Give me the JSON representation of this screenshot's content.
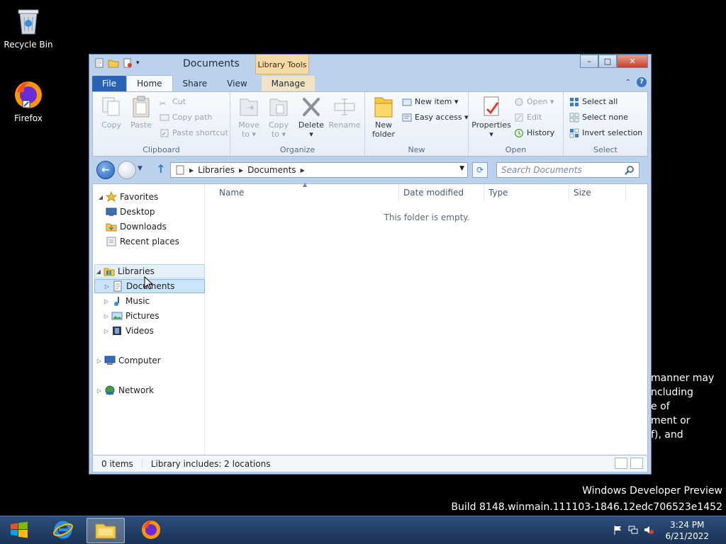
{
  "desktop": {
    "icons": [
      {
        "label": "Recycle Bin"
      },
      {
        "label": "Firefox"
      }
    ],
    "watermark_line1": "Windows Developer Preview",
    "watermark_line2": "Build 8148.winmain.111103-1846.12edc706523e1452",
    "background_text": "manner may\nncluding\ne of\nment or\nf), and"
  },
  "window": {
    "title": "Documents",
    "contextual_tab_group": "Library Tools",
    "buttons": {
      "minimize": "–",
      "maximize": "□",
      "close": "✕"
    }
  },
  "ribbon": {
    "tabs": [
      {
        "label": "File"
      },
      {
        "label": "Home"
      },
      {
        "label": "Share"
      },
      {
        "label": "View"
      },
      {
        "label": "Manage"
      }
    ],
    "help_label": "?",
    "groups": {
      "clipboard": {
        "label": "Clipboard",
        "copy": "Copy",
        "paste": "Paste",
        "cut": "Cut",
        "copy_path": "Copy path",
        "paste_shortcut": "Paste shortcut"
      },
      "organize": {
        "label": "Organize",
        "move_to": "Move to ▾",
        "copy_to": "Copy to ▾",
        "delete": "Delete ▾",
        "rename": "Rename"
      },
      "new": {
        "label": "New",
        "new_folder": "New folder",
        "new_item": "New item ▾",
        "easy_access": "Easy access ▾"
      },
      "open": {
        "label": "Open",
        "properties": "Properties ▾",
        "open": "Open ▾",
        "edit": "Edit",
        "history": "History"
      },
      "select": {
        "label": "Select",
        "select_all": "Select all",
        "select_none": "Select none",
        "invert_selection": "Invert selection"
      }
    }
  },
  "address": {
    "crumbs": [
      "Libraries",
      "Documents"
    ],
    "search_placeholder": "Search Documents"
  },
  "navpane": {
    "items": [
      {
        "label": "Favorites"
      },
      {
        "label": "Desktop"
      },
      {
        "label": "Downloads"
      },
      {
        "label": "Recent places"
      },
      {
        "label": "Libraries"
      },
      {
        "label": "Documents"
      },
      {
        "label": "Music"
      },
      {
        "label": "Pictures"
      },
      {
        "label": "Videos"
      },
      {
        "label": "Computer"
      },
      {
        "label": "Network"
      }
    ]
  },
  "filelist": {
    "columns": [
      "Name",
      "Date modified",
      "Type",
      "Size"
    ],
    "empty_message": "This folder is empty."
  },
  "status": {
    "items": "0 items",
    "library": "Library includes: 2 locations"
  },
  "taskbar": {
    "time": "3:24 PM",
    "date": "6/21/2022"
  },
  "colors": {
    "accent": "#2a62b8",
    "window_frame": "#bcd2ec",
    "selection": "#cce4fa"
  }
}
